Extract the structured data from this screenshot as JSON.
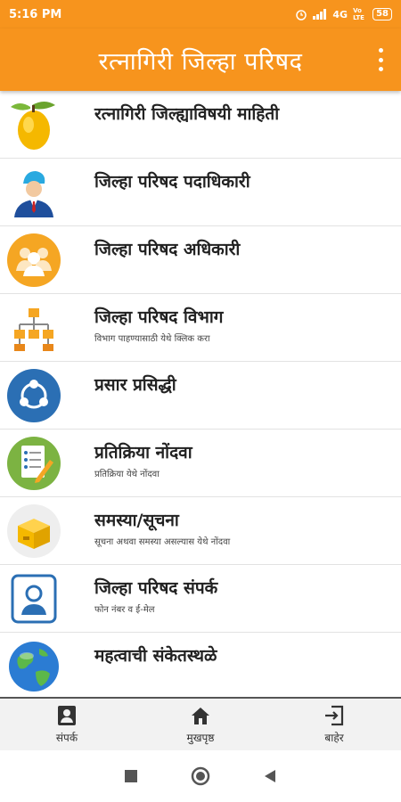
{
  "status_bar": {
    "time": "5:16 PM",
    "network": "4G",
    "volte": "Vo LTE",
    "battery": "58"
  },
  "app_bar": {
    "title": "रत्नागिरी जिल्हा परिषद",
    "menu_icon": "more-vert-icon"
  },
  "menu": {
    "items": [
      {
        "title": "रत्नागिरी जिल्ह्याविषयी माहिती",
        "subtitle": "",
        "icon": "mango-icon"
      },
      {
        "title": "जिल्हा परिषद पदाधिकारी",
        "subtitle": "",
        "icon": "official-person-icon"
      },
      {
        "title": "जिल्हा परिषद अधिकारी",
        "subtitle": "",
        "icon": "group-icon"
      },
      {
        "title": "जिल्हा परिषद विभाग",
        "subtitle": "विभाग पाहण्यासाठी येथे क्लिक करा",
        "icon": "org-chart-icon"
      },
      {
        "title": "प्रसार प्रसिद्धी",
        "subtitle": "",
        "icon": "share-icon"
      },
      {
        "title": "प्रतिक्रिया नोंदवा",
        "subtitle": "प्रतिक्रिया येथे नोंदवा",
        "icon": "feedback-form-icon"
      },
      {
        "title": "समस्या/सूचना",
        "subtitle": "सूचना अथवा समस्या असल्यास येथे नोंदवा",
        "icon": "box-icon"
      },
      {
        "title": "जिल्हा परिषद संपर्क",
        "subtitle": "फोन नंबर व ई-मेल",
        "icon": "contact-card-icon"
      },
      {
        "title": "महत्वाची संकेतस्थळे",
        "subtitle": "",
        "icon": "globe-icon"
      }
    ]
  },
  "bottom_nav": {
    "items": [
      {
        "label": "संपर्क",
        "icon": "contact-icon"
      },
      {
        "label": "मुखपृष्ठ",
        "icon": "home-icon"
      },
      {
        "label": "बाहेर",
        "icon": "exit-icon"
      }
    ]
  },
  "colors": {
    "accent": "#f7941d"
  }
}
